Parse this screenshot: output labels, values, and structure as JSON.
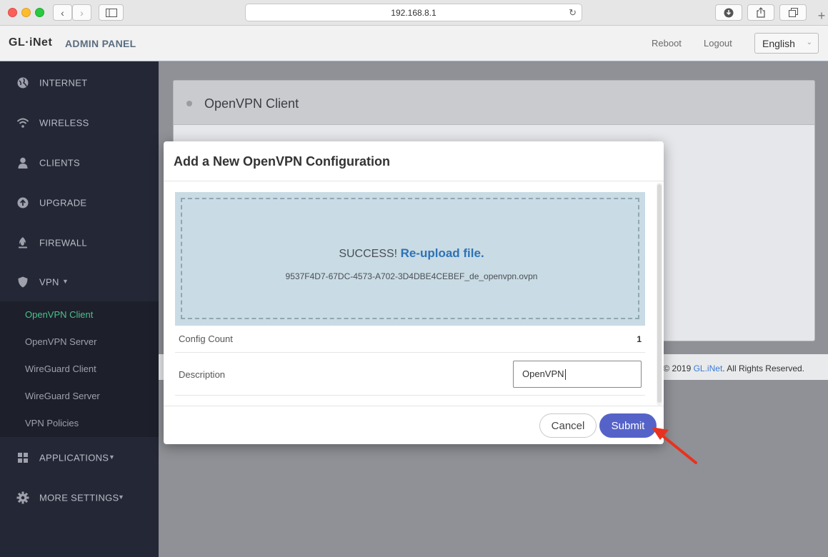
{
  "browser": {
    "url": "192.168.8.1"
  },
  "header": {
    "logo": "GL·iNet",
    "admin_label": "ADMIN PANEL",
    "reboot": "Reboot",
    "logout": "Logout",
    "language": "English"
  },
  "sidebar": {
    "items": [
      {
        "label": "INTERNET",
        "icon": "globe-icon"
      },
      {
        "label": "WIRELESS",
        "icon": "wifi-icon"
      },
      {
        "label": "CLIENTS",
        "icon": "user-icon"
      },
      {
        "label": "UPGRADE",
        "icon": "upload-icon"
      },
      {
        "label": "FIREWALL",
        "icon": "flame-icon"
      },
      {
        "label": "VPN",
        "icon": "shield-icon"
      },
      {
        "label": "APPLICATIONS",
        "icon": "grid-icon"
      },
      {
        "label": "MORE SETTINGS",
        "icon": "gear-icon"
      }
    ],
    "vpn_sub": [
      {
        "label": "OpenVPN Client",
        "active": true
      },
      {
        "label": "OpenVPN Server"
      },
      {
        "label": "WireGuard Client"
      },
      {
        "label": "WireGuard Server"
      },
      {
        "label": "VPN Policies"
      }
    ]
  },
  "main": {
    "panel_title": "OpenVPN Client",
    "footer_prefix": "© 2019 ",
    "footer_brand": "GL.iNet",
    "footer_suffix": ". All Rights Reserved."
  },
  "modal": {
    "title": "Add a New OpenVPN Configuration",
    "success_text": "SUCCESS!",
    "reupload_link": "Re-upload file.",
    "filename": "9537F4D7-67DC-4573-A702-3D4DBE4CEBEF_de_openvpn.ovpn",
    "config_count_label": "Config Count",
    "config_count_value": "1",
    "description_label": "Description",
    "description_value": "OpenVPN",
    "cancel": "Cancel",
    "submit": "Submit"
  },
  "colors": {
    "sidebar_bg": "#242736",
    "active_green": "#4bc28a",
    "submit_blue": "#5563c9",
    "arrow_red": "#e8321e"
  }
}
